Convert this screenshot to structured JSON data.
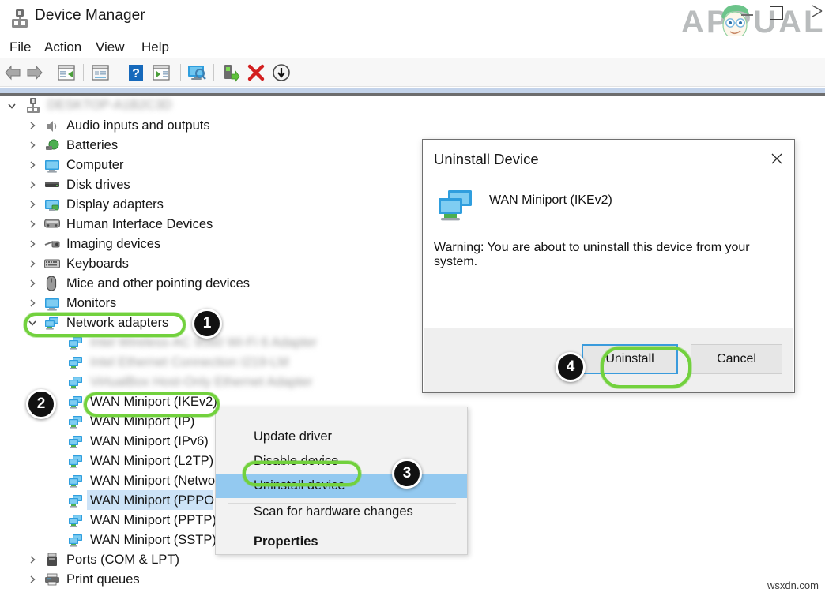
{
  "window": {
    "title": "Device Manager",
    "app_icon": "device-manager-icon",
    "minimize_label": "Minimize",
    "restore_label": "Restore",
    "close_label": "Close"
  },
  "brand": {
    "text": "APPUALS",
    "watermark": "wsxdn.com"
  },
  "menubar": {
    "items": [
      {
        "label": "File"
      },
      {
        "label": "Action"
      },
      {
        "label": "View"
      },
      {
        "label": "Help"
      }
    ]
  },
  "toolbar": {
    "buttons": [
      {
        "icon": "back-arrow-icon",
        "label": "Back"
      },
      {
        "icon": "forward-arrow-icon",
        "label": "Forward"
      },
      {
        "icon": "up-one-level-icon",
        "label": "Up one level"
      },
      {
        "icon": "properties-icon",
        "label": "Properties"
      },
      {
        "icon": "help-icon",
        "label": "Help"
      },
      {
        "icon": "show-hidden-icon",
        "label": "Show hidden devices"
      },
      {
        "icon": "scan-hardware-icon",
        "label": "Scan for hardware changes"
      },
      {
        "icon": "update-driver-icon",
        "label": "Update driver"
      },
      {
        "icon": "uninstall-device-icon",
        "label": "Uninstall device"
      },
      {
        "icon": "disable-device-icon",
        "label": "Disable device"
      }
    ]
  },
  "tree": {
    "root": {
      "label": "",
      "blurred": true,
      "icon": "computer-root-icon",
      "expanded": true
    },
    "categories": [
      {
        "label": "Audio inputs and outputs",
        "icon": "speaker-icon",
        "expanded": false
      },
      {
        "label": "Batteries",
        "icon": "battery-icon",
        "expanded": false
      },
      {
        "label": "Computer",
        "icon": "monitor-icon",
        "expanded": false
      },
      {
        "label": "Disk drives",
        "icon": "disk-icon",
        "expanded": false
      },
      {
        "label": "Display adapters",
        "icon": "display-adapter-icon",
        "expanded": false
      },
      {
        "label": "Human Interface Devices",
        "icon": "hid-icon",
        "expanded": false
      },
      {
        "label": "Imaging devices",
        "icon": "camera-icon",
        "expanded": false
      },
      {
        "label": "Keyboards",
        "icon": "keyboard-icon",
        "expanded": false
      },
      {
        "label": "Mice and other pointing devices",
        "icon": "mouse-icon",
        "expanded": false
      },
      {
        "label": "Monitors",
        "icon": "monitor-icon",
        "expanded": false
      },
      {
        "label": "Network adapters",
        "icon": "network-adapter-icon",
        "expanded": true
      }
    ],
    "network_children": [
      {
        "label": "",
        "blurred": true
      },
      {
        "label": "",
        "blurred": true
      },
      {
        "label": "",
        "blurred": true
      },
      {
        "label": "WAN Miniport (IKEv2)",
        "selected": true
      },
      {
        "label": "WAN Miniport (IP)"
      },
      {
        "label": "WAN Miniport (IPv6)"
      },
      {
        "label": "WAN Miniport (L2TP)"
      },
      {
        "label": "WAN Miniport (Netwo"
      },
      {
        "label": "WAN Miniport (PPPOE"
      },
      {
        "label": "WAN Miniport (PPTP)"
      },
      {
        "label": "WAN Miniport (SSTP)"
      }
    ],
    "trailing_categories": [
      {
        "label": "Ports (COM & LPT)",
        "icon": "port-icon",
        "expanded": false
      },
      {
        "label": "Print queues",
        "icon": "printer-icon",
        "expanded": false
      }
    ]
  },
  "context_menu": {
    "items": [
      {
        "label": "Update driver",
        "highlighted": false,
        "bold": false
      },
      {
        "label": "Disable device",
        "highlighted": false,
        "bold": false
      },
      {
        "label": "Uninstall device",
        "highlighted": true,
        "bold": false
      },
      {
        "label": "Scan for hardware changes",
        "highlighted": false,
        "bold": false
      },
      {
        "label": "Properties",
        "highlighted": false,
        "bold": true
      }
    ]
  },
  "dialog": {
    "title": "Uninstall Device",
    "close_icon": "close-icon",
    "device_icon": "network-adapter-icon",
    "device_name": "WAN Miniport (IKEv2)",
    "warning": "Warning: You are about to uninstall this device from your system.",
    "buttons": {
      "primary": "Uninstall",
      "secondary": "Cancel"
    }
  },
  "annotations": {
    "accent_color": "#72d13d",
    "badge_color": "#111111",
    "steps": [
      {
        "number": "1",
        "target": "Network adapters"
      },
      {
        "number": "2",
        "target": "WAN Miniport (IKEv2)"
      },
      {
        "number": "3",
        "target": "Uninstall device"
      },
      {
        "number": "4",
        "target": "Uninstall"
      }
    ]
  }
}
